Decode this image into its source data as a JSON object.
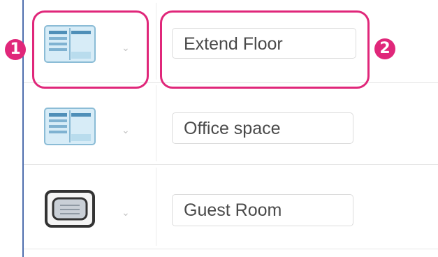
{
  "rows": [
    {
      "type_icon": "floor-plan-icon",
      "name": "Extend Floor"
    },
    {
      "type_icon": "floor-plan-icon",
      "name": "Office space"
    },
    {
      "type_icon": "room-icon",
      "name": "Guest Room"
    }
  ],
  "callouts": {
    "one": "1",
    "two": "2"
  },
  "colors": {
    "highlight": "#e0277a",
    "accent_rule": "#4f6fae",
    "border": "#dcdcdc"
  },
  "chevron_glyph": "⌄"
}
